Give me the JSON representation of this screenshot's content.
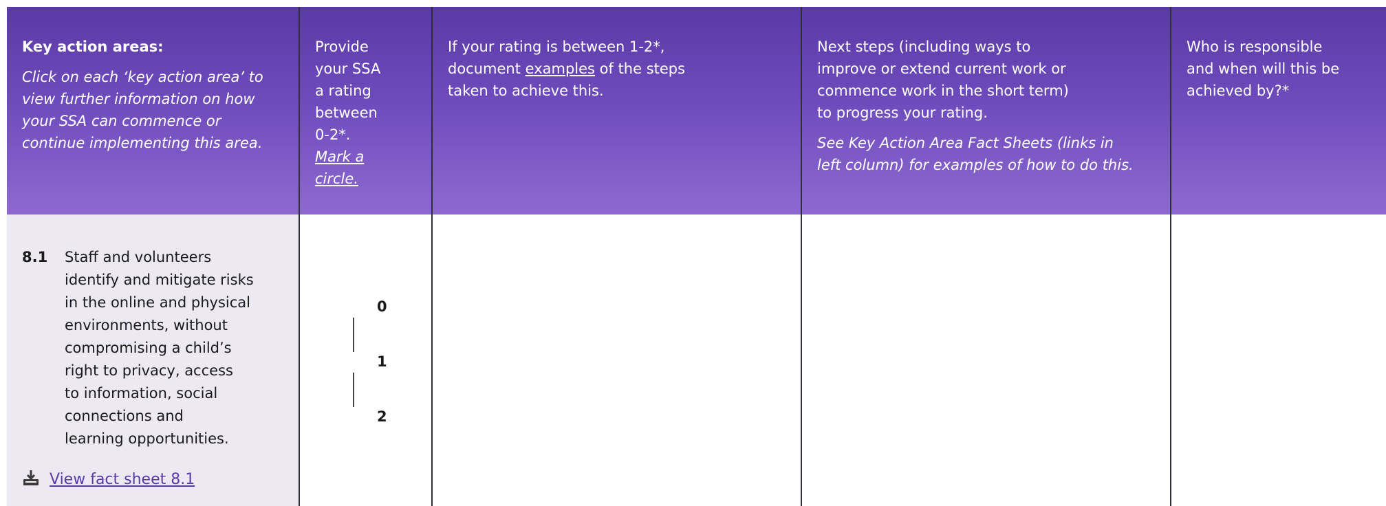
{
  "header": {
    "col1": {
      "title": "Key action areas:",
      "instruction": "Click on each ‘key action area’ to view further information on how your SSA can commence or continue implementing this area."
    },
    "col2": {
      "line1": "Provide",
      "line2": "your SSA",
      "line3": "a rating",
      "line4": "between",
      "line5": "0-2*.",
      "link1": "Mark a",
      "link2": "circle."
    },
    "col3": {
      "line1": "If your rating is between 1-2*,",
      "before_link": "document ",
      "link": "examples",
      "after_link": " of the steps",
      "line3": "taken to achieve this."
    },
    "col4": {
      "line1": "Next steps (including ways to",
      "line2": "improve or extend current work or",
      "line3": "commence work in the short term)",
      "line4": "to progress your rating.",
      "note1": "See Key Action Area Fact Sheets (links in",
      "note2": "left column) for examples of how to do this."
    },
    "col5": {
      "line1": "Who is responsible",
      "line2": "and when will this be",
      "line3": "achieved by?*"
    }
  },
  "row": {
    "number": "8.1",
    "lines": [
      "Staff and volunteers",
      "identify and mitigate risks",
      "in the online and physical",
      "environments, without",
      "compromising a child’s",
      "right to privacy, access",
      "to information, social",
      "connections and",
      "learning opportunities."
    ],
    "fact_sheet_label": "View fact sheet 8.1",
    "ratings": [
      "0",
      "1",
      "2"
    ]
  },
  "icons": {
    "download": "download-icon"
  },
  "colors": {
    "header_top": "#5a3aa6",
    "header_bottom": "#8d69cf",
    "left_cell": "#ece9f2",
    "link": "#5a3aa6"
  }
}
